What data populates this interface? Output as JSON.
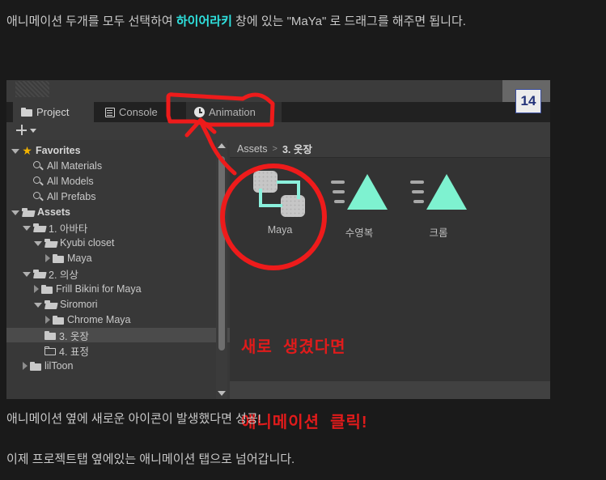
{
  "page": {
    "intro_line_parts": {
      "before": "애니메이션 두개를 모두 선택하여 ",
      "highlight": "하이어라키",
      "after": " 창에 있는 \"MaYa\" 로 드래그를 해주면 됩니다."
    },
    "outro_line_1": "애니메이션 옆에 새로운 아이콘이 발생했다면 성공!",
    "outro_line_2": "이제 프로젝트탭 옆에있는 애니메이션 탭으로 넘어갑니다.",
    "background": "#1a1a1a",
    "text_color": "#c8c8c8",
    "highlight_color": "#2fe3e0"
  },
  "editor": {
    "tabs": [
      {
        "label": "Project",
        "icon": "folder-icon",
        "active": true
      },
      {
        "label": "Console",
        "icon": "console-list-icon",
        "active": false
      },
      {
        "label": "Animation",
        "icon": "clock-icon",
        "active": false
      }
    ],
    "toolbar": {
      "add_label": "+",
      "dropdown_icon": "chevron-down-icon"
    },
    "breadcrumb": {
      "root": "Assets",
      "separator": ">",
      "current": "3. 옷장"
    },
    "tree": [
      {
        "label": "Favorites",
        "indent": 0,
        "arrow": "down",
        "icon": "star-icon",
        "bold": true,
        "selected": false
      },
      {
        "label": "All Materials",
        "indent": 1,
        "arrow": "none",
        "icon": "search-icon",
        "bold": false,
        "selected": false
      },
      {
        "label": "All Models",
        "indent": 1,
        "arrow": "none",
        "icon": "search-icon",
        "bold": false,
        "selected": false
      },
      {
        "label": "All Prefabs",
        "indent": 1,
        "arrow": "none",
        "icon": "search-icon",
        "bold": false,
        "selected": false
      },
      {
        "label": "Assets",
        "indent": 0,
        "arrow": "down",
        "icon": "folder-open-icon",
        "bold": true,
        "selected": false
      },
      {
        "label": "1. 아바타",
        "indent": 1,
        "arrow": "down",
        "icon": "folder-open-icon",
        "bold": false,
        "selected": false
      },
      {
        "label": "Kyubi closet",
        "indent": 2,
        "arrow": "down",
        "icon": "folder-open-icon",
        "bold": false,
        "selected": false
      },
      {
        "label": "Maya",
        "indent": 3,
        "arrow": "right",
        "icon": "folder-closed-icon",
        "bold": false,
        "selected": false
      },
      {
        "label": "2. 의상",
        "indent": 1,
        "arrow": "down",
        "icon": "folder-open-icon",
        "bold": false,
        "selected": false
      },
      {
        "label": "Frill Bikini for Maya",
        "indent": 2,
        "arrow": "right",
        "icon": "folder-closed-icon",
        "bold": false,
        "selected": false
      },
      {
        "label": "Siromori",
        "indent": 2,
        "arrow": "down",
        "icon": "folder-open-icon",
        "bold": false,
        "selected": false
      },
      {
        "label": "Chrome Maya",
        "indent": 3,
        "arrow": "right",
        "icon": "folder-closed-icon",
        "bold": false,
        "selected": false
      },
      {
        "label": "3. 옷장",
        "indent": 2,
        "arrow": "none",
        "icon": "folder-closed-icon",
        "bold": false,
        "selected": true
      },
      {
        "label": "4. 표정",
        "indent": 2,
        "arrow": "none",
        "icon": "folder-empty-icon",
        "bold": false,
        "selected": false
      },
      {
        "label": "lilToon",
        "indent": 1,
        "arrow": "right",
        "icon": "folder-closed-icon",
        "bold": false,
        "selected": false
      }
    ],
    "assets": [
      {
        "label": "Maya",
        "icon": "animator-controller-icon",
        "circled": true
      },
      {
        "label": "수영복",
        "icon": "animation-clip-icon",
        "circled": false
      },
      {
        "label": "크롬",
        "icon": "animation-clip-icon",
        "circled": false
      }
    ],
    "colors": {
      "panel_bg": "#383838",
      "content_bg": "#333333",
      "tab_active_bg": "#3b3b3b",
      "selection_bg": "#4b4b4b",
      "asset_accent": "#7ef2d0"
    }
  },
  "annotations": {
    "red_note_line_1": "새로  생겼다면",
    "red_note_line_2": "애니메이션  클릭!",
    "red_color": "#e01b1b",
    "badge_number": "14"
  }
}
